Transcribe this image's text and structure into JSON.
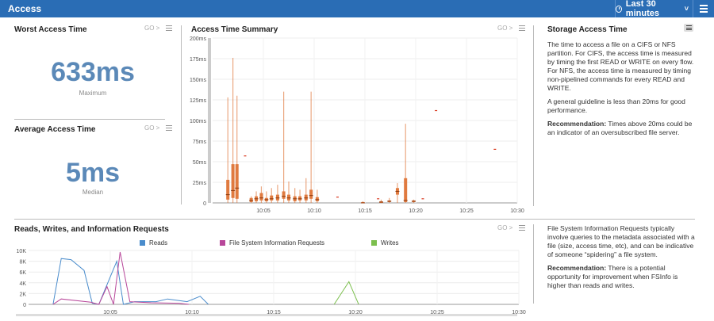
{
  "header": {
    "title": "Access",
    "time_range": "Last 30 minutes",
    "chevron": "˅"
  },
  "worst": {
    "title": "Worst Access Time",
    "value": "633ms",
    "label": "Maximum",
    "go": "GO >"
  },
  "average": {
    "title": "Average Access Time",
    "value": "5ms",
    "label": "Median",
    "go": "GO >"
  },
  "summary": {
    "title": "Access Time Summary",
    "go": "GO >"
  },
  "storage": {
    "title": "Storage Access Time",
    "p1": "The time to access a file on a CIFS or NFS partition. For CIFS, the access time is measured by timing the first READ or WRITE on every flow. For NFS, the access time is measured by timing non-pipelined commands for every READ and WRITE.",
    "p2": "A general guideline is less than 20ms for good performance.",
    "rec_label": "Recommendation:",
    "rec_text": " Times above 20ms could be an indicator of an oversubscribed file server."
  },
  "requests": {
    "title": "Reads, Writes, and Information Requests",
    "go": "GO >"
  },
  "fsinfo": {
    "p1": "File System Information Requests typically involve queries to the metadata associated with a file (size, access time, etc), and can be indicative of someone “spidering” a file system.",
    "rec_label": "Recommendation:",
    "rec_text": " There is a potential opportunity for improvement when FSInfo is higher than reads and writes."
  },
  "colors": {
    "header": "#2a6db5",
    "bignum": "#5b89b8",
    "box": "#e07a3f",
    "reads": "#4a8ccc",
    "fsinfo": "#b8479a",
    "writes": "#7cbf4e"
  },
  "chart_data": [
    {
      "type": "box",
      "title": "Access Time Summary",
      "yticks": [
        "0",
        "25ms",
        "50ms",
        "75ms",
        "100ms",
        "125ms",
        "150ms",
        "175ms",
        "200ms"
      ],
      "ylim": [
        0,
        200
      ],
      "xticks": [
        "10:05",
        "10:10",
        "10:15",
        "10:20",
        "10:25",
        "10:30"
      ],
      "xlim": [
        "10:00",
        "10:30"
      ],
      "boxes": [
        {
          "x": "10:01.5",
          "whiskerLow": 0,
          "q1": 4,
          "med": 10,
          "q3": 28,
          "whiskerHigh": 128
        },
        {
          "x": "10:02.0",
          "whiskerLow": 0,
          "q1": 6,
          "med": 15,
          "q3": 47,
          "whiskerHigh": 176
        },
        {
          "x": "10:02.4",
          "whiskerLow": 0,
          "q1": 5,
          "med": 18,
          "q3": 47,
          "whiskerHigh": 130
        },
        {
          "x": "10:03.8",
          "whiskerLow": 0,
          "q1": 1,
          "med": 3,
          "q3": 6,
          "whiskerHigh": 8
        },
        {
          "x": "10:04.3",
          "whiskerLow": 0,
          "q1": 2,
          "med": 5,
          "q3": 8,
          "whiskerHigh": 14
        },
        {
          "x": "10:04.8",
          "whiskerLow": 0,
          "q1": 3,
          "med": 6,
          "q3": 12,
          "whiskerHigh": 20
        },
        {
          "x": "10:05.3",
          "whiskerLow": 0,
          "q1": 2,
          "med": 4,
          "q3": 6,
          "whiskerHigh": 14
        },
        {
          "x": "10:05.8",
          "whiskerLow": 0,
          "q1": 3,
          "med": 5,
          "q3": 9,
          "whiskerHigh": 18
        },
        {
          "x": "10:06.4",
          "whiskerLow": 0,
          "q1": 3,
          "med": 6,
          "q3": 10,
          "whiskerHigh": 22
        },
        {
          "x": "10:07.0",
          "whiskerLow": 0,
          "q1": 5,
          "med": 8,
          "q3": 14,
          "whiskerHigh": 135
        },
        {
          "x": "10:07.5",
          "whiskerLow": 0,
          "q1": 3,
          "med": 6,
          "q3": 10,
          "whiskerHigh": 26
        },
        {
          "x": "10:08.1",
          "whiskerLow": 0,
          "q1": 2,
          "med": 5,
          "q3": 8,
          "whiskerHigh": 18
        },
        {
          "x": "10:08.6",
          "whiskerLow": 0,
          "q1": 3,
          "med": 5,
          "q3": 8,
          "whiskerHigh": 16
        },
        {
          "x": "10:09.2",
          "whiskerLow": 0,
          "q1": 3,
          "med": 6,
          "q3": 10,
          "whiskerHigh": 30
        },
        {
          "x": "10:09.7",
          "whiskerLow": 0,
          "q1": 5,
          "med": 9,
          "q3": 16,
          "whiskerHigh": 135
        },
        {
          "x": "10:10.3",
          "whiskerLow": 0,
          "q1": 2,
          "med": 4,
          "q3": 7,
          "whiskerHigh": 16
        },
        {
          "x": "10:14.8",
          "whiskerLow": 0,
          "q1": 0,
          "med": 0,
          "q3": 1,
          "whiskerHigh": 2
        },
        {
          "x": "10:16.6",
          "whiskerLow": 0,
          "q1": 0,
          "med": 1,
          "q3": 2,
          "whiskerHigh": 4
        },
        {
          "x": "10:17.4",
          "whiskerLow": 0,
          "q1": 1,
          "med": 2,
          "q3": 3,
          "whiskerHigh": 6
        },
        {
          "x": "10:18.2",
          "whiskerLow": 0,
          "q1": 10,
          "med": 14,
          "q3": 18,
          "whiskerHigh": 24
        },
        {
          "x": "10:19.0",
          "whiskerLow": 0,
          "q1": 1,
          "med": 3,
          "q3": 30,
          "whiskerHigh": 96
        },
        {
          "x": "10:19.8",
          "whiskerLow": 0,
          "q1": 1,
          "med": 2,
          "q3": 3,
          "whiskerHigh": 4
        }
      ],
      "outliers": [
        {
          "x": "10:03.2",
          "y": 57
        },
        {
          "x": "10:12.3",
          "y": 7
        },
        {
          "x": "10:16.3",
          "y": 5
        },
        {
          "x": "10:20.7",
          "y": 5
        },
        {
          "x": "10:22.0",
          "y": 112
        },
        {
          "x": "10:27.8",
          "y": 65
        }
      ],
      "grid": true
    },
    {
      "type": "line",
      "title": "Reads, Writes, and Information Requests",
      "yticks": [
        "0",
        "2K",
        "4K",
        "6K",
        "8K",
        "10K"
      ],
      "ylim": [
        0,
        10000
      ],
      "xticks": [
        "10:05",
        "10:10",
        "10:15",
        "10:20",
        "10:25",
        "10:30"
      ],
      "xlim": [
        "10:00",
        "10:30"
      ],
      "legend": "top",
      "series": [
        {
          "name": "Reads",
          "points": [
            [
              "10:01.5",
              0
            ],
            [
              "10:02.0",
              8500
            ],
            [
              "10:02.6",
              8300
            ],
            [
              "10:03.4",
              6300
            ],
            [
              "10:03.9",
              200
            ],
            [
              "10:04.3",
              0
            ],
            [
              "10:05.4",
              8000
            ],
            [
              "10:05.8",
              0
            ],
            [
              "10:06.5",
              500
            ],
            [
              "10:07.8",
              500
            ],
            [
              "10:08.5",
              1000
            ],
            [
              "10:09.7",
              500
            ],
            [
              "10:10.5",
              1500
            ],
            [
              "10:11.0",
              0
            ]
          ]
        },
        {
          "name": "File System Information Requests",
          "points": [
            [
              "10:01.5",
              0
            ],
            [
              "10:02.0",
              1000
            ],
            [
              "10:03.8",
              400
            ],
            [
              "10:04.3",
              0
            ],
            [
              "10:04.8",
              3300
            ],
            [
              "10:05.2",
              0
            ],
            [
              "10:05.6",
              9700
            ],
            [
              "10:06.2",
              500
            ],
            [
              "10:07.5",
              300
            ],
            [
              "10:09.2",
              200
            ],
            [
              "10:09.8",
              0
            ]
          ]
        },
        {
          "name": "Writes",
          "points": [
            [
              "10:18.7",
              0
            ],
            [
              "10:19.6",
              4200
            ],
            [
              "10:20.2",
              0
            ]
          ]
        }
      ],
      "grid": true
    }
  ]
}
